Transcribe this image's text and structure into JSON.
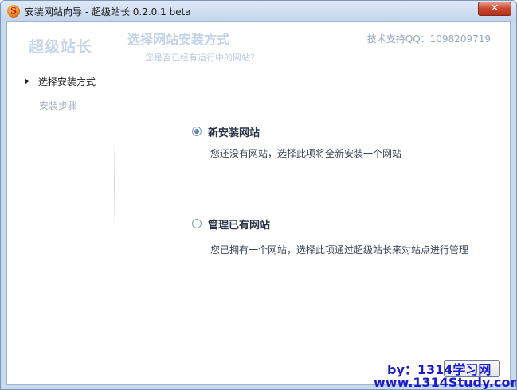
{
  "window": {
    "title": "安装网站向导 - 超级站长 0.2.0.1 beta",
    "close_label": "✕"
  },
  "header": {
    "brand": "超级站长",
    "title": "选择网站安装方式",
    "subtitle": "您是否已经有运行中的网站?",
    "support": "技术支持QQ：1098209719"
  },
  "sidebar": {
    "items": [
      {
        "label": "选择安装方式",
        "active": true
      },
      {
        "label": "安装步骤",
        "active": false
      }
    ]
  },
  "options": [
    {
      "label": "新安装网站",
      "description": "您还没有网站，选择此项将全新安装一个网站",
      "checked": true
    },
    {
      "label": "管理已有网站",
      "description": "您已拥有一个网站，选择此项通过超级站长来对站点进行管理",
      "checked": false
    }
  ],
  "watermark": {
    "by": "by：1314学习网",
    "url": "www.1314Study.com"
  },
  "colors": {
    "accent": "#1d4f9f",
    "watermark": "#1a1ad8",
    "close": "#c7452c"
  }
}
